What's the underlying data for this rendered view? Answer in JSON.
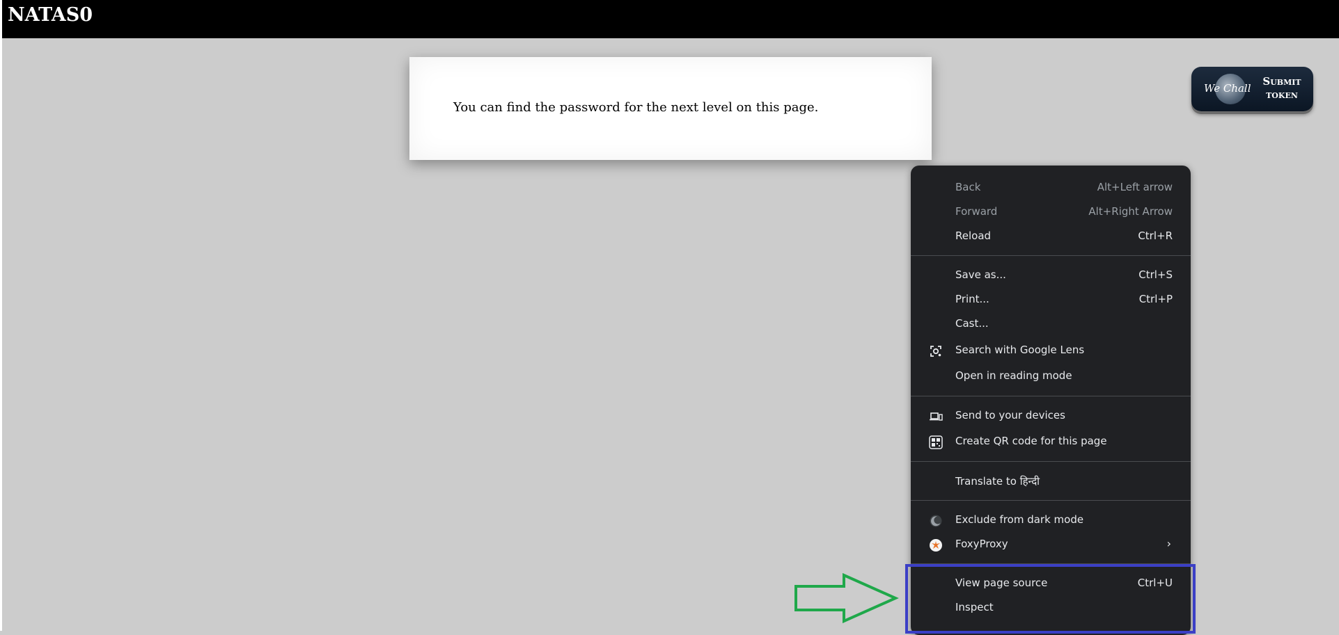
{
  "page": {
    "title": "NATAS0",
    "message": "You can find the password for the next level on this page."
  },
  "wechall": {
    "logo_text": "We Chall",
    "label_line1": "Submit",
    "label_line2": "token"
  },
  "context_menu": {
    "back": {
      "label": "Back",
      "shortcut": "Alt+Left arrow"
    },
    "forward": {
      "label": "Forward",
      "shortcut": "Alt+Right Arrow"
    },
    "reload": {
      "label": "Reload",
      "shortcut": "Ctrl+R"
    },
    "save_as": {
      "label": "Save as...",
      "shortcut": "Ctrl+S"
    },
    "print": {
      "label": "Print...",
      "shortcut": "Ctrl+P"
    },
    "cast": {
      "label": "Cast..."
    },
    "google_lens": {
      "label": "Search with Google Lens",
      "icon": "google-lens-icon"
    },
    "reading_mode": {
      "label": "Open in reading mode"
    },
    "send_devices": {
      "label": "Send to your devices",
      "icon": "devices-icon"
    },
    "qr_code": {
      "label": "Create QR code for this page",
      "icon": "qr-code-icon"
    },
    "translate": {
      "label": "Translate to हिन्दी"
    },
    "dark_mode": {
      "label": "Exclude from dark mode",
      "icon": "moon-icon"
    },
    "foxyproxy": {
      "label": "FoxyProxy",
      "icon": "foxyproxy-icon"
    },
    "view_source": {
      "label": "View page source",
      "shortcut": "Ctrl+U"
    },
    "inspect": {
      "label": "Inspect"
    }
  },
  "colors": {
    "page_background": "#cccccc",
    "menu_background": "#202124",
    "highlight_box": "#3b3fc6",
    "arrow": "#1fa84a"
  }
}
